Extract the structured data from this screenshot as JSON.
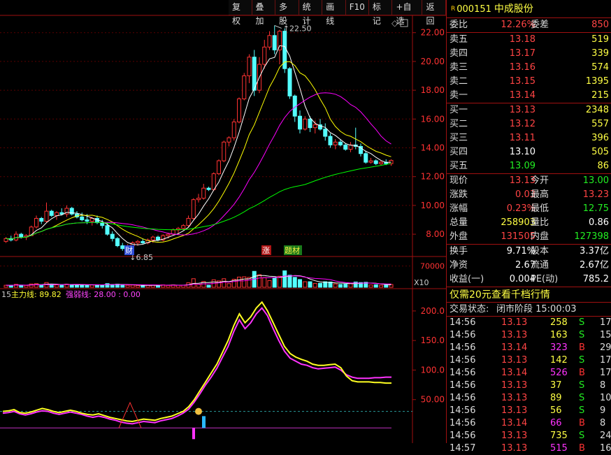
{
  "toolbar": [
    "复权",
    "叠加",
    "多股",
    "统计",
    "画线",
    "F10",
    "标记",
    "+自选",
    "返回"
  ],
  "stock": {
    "marker": "R",
    "code": "000151",
    "name": "中成股份"
  },
  "weibi": {
    "label": "委比",
    "value": "12.26%",
    "label2": "委差",
    "value2": "850"
  },
  "asks": [
    {
      "label": "卖五",
      "price": "13.18",
      "vol": "519"
    },
    {
      "label": "卖四",
      "price": "13.17",
      "vol": "339"
    },
    {
      "label": "卖三",
      "price": "13.16",
      "vol": "574"
    },
    {
      "label": "卖二",
      "price": "13.15",
      "vol": "1395"
    },
    {
      "label": "卖一",
      "price": "13.14",
      "vol": "215"
    }
  ],
  "bids": [
    {
      "label": "买一",
      "price": "13.13",
      "vol": "2348"
    },
    {
      "label": "买二",
      "price": "13.12",
      "vol": "557"
    },
    {
      "label": "买三",
      "price": "13.11",
      "vol": "396"
    },
    {
      "label": "买四",
      "price": "13.10",
      "vol": "505"
    },
    {
      "label": "买五",
      "price": "13.09",
      "vol": "86"
    }
  ],
  "quote": [
    {
      "l1": "现价",
      "v1": "13.13",
      "l2": "今开",
      "v2": "13.00"
    },
    {
      "l1": "涨跌",
      "v1": "0.03",
      "l2": "最高",
      "v2": "13.23"
    },
    {
      "l1": "涨幅",
      "v1": "0.23%",
      "l2": "最低",
      "v2": "12.75"
    },
    {
      "l1": "总量",
      "v1": "258903",
      "l2": "量比",
      "v2": "0.86"
    },
    {
      "l1": "外盘",
      "v1": "131505",
      "l2": "内盘",
      "v2": "127398"
    }
  ],
  "fundamentals": [
    {
      "l1": "换手",
      "v1": "9.71%",
      "l2": "股本",
      "v2": "3.37亿"
    },
    {
      "l1": "净资",
      "v1": "2.67",
      "l2": "流通",
      "v2": "2.67亿"
    },
    {
      "l1": "收益(一)",
      "v1": "0.004",
      "l2": "PE(动)",
      "v2": "785.2"
    }
  ],
  "promo": "仅需20元查看千档行情",
  "status": {
    "label": "交易状态:",
    "value": "闭市阶段 15:00:03"
  },
  "ticks": [
    {
      "time": "14:56",
      "price": "13.13",
      "vol": "258",
      "side": "S",
      "n": "17"
    },
    {
      "time": "14:56",
      "price": "13.13",
      "vol": "163",
      "side": "S",
      "n": "15"
    },
    {
      "time": "14:56",
      "price": "13.14",
      "vol": "323",
      "side": "B",
      "n": "29"
    },
    {
      "time": "14:56",
      "price": "13.13",
      "vol": "142",
      "side": "S",
      "n": "17"
    },
    {
      "time": "14:56",
      "price": "13.14",
      "vol": "526",
      "side": "B",
      "n": "17"
    },
    {
      "time": "14:56",
      "price": "13.13",
      "vol": "37",
      "side": "S",
      "n": "8"
    },
    {
      "time": "14:56",
      "price": "13.13",
      "vol": "89",
      "side": "S",
      "n": "10"
    },
    {
      "time": "14:56",
      "price": "13.13",
      "vol": "56",
      "side": "S",
      "n": "9"
    },
    {
      "time": "14:56",
      "price": "13.14",
      "vol": "66",
      "side": "B",
      "n": "8"
    },
    {
      "time": "14:56",
      "price": "13.13",
      "vol": "735",
      "side": "S",
      "n": "24"
    },
    {
      "time": "14:57",
      "price": "13.13",
      "vol": "515",
      "side": "B",
      "n": "16"
    }
  ],
  "price_axis": [
    "22.00",
    "20.00",
    "18.00",
    "16.00",
    "14.00",
    "12.00",
    "10.00",
    "8.00"
  ],
  "high_label": "22.50",
  "low_label": "6.85",
  "event_labels": [
    "财",
    "涨",
    "题材"
  ],
  "vol_axis": {
    "value": "70000",
    "unit": "X10"
  },
  "indicator": {
    "prefix": "15",
    "main": "主力线: 89.82",
    "strong": "强弱线: 28.00 : 0.00"
  },
  "ind_axis": [
    "200.0",
    "150.0",
    "100.0",
    "50.00"
  ],
  "colors": {
    "up": "#ff3232",
    "down": "#54ffff",
    "ma5": "#ffffff",
    "ma10": "#ffff00",
    "ma20": "#ff00ff",
    "ma60": "#00ff00",
    "border": "#a01010"
  },
  "chart_data": {
    "type": "candlestick",
    "note_series": [
      "MA5",
      "MA10",
      "MA20",
      "MA60"
    ],
    "candles": [
      [
        7.5,
        7.8,
        7.4,
        7.7
      ],
      [
        7.7,
        7.9,
        7.5,
        7.6
      ],
      [
        7.6,
        8.2,
        7.5,
        8.0
      ],
      [
        8.0,
        8.1,
        7.7,
        7.8
      ],
      [
        7.8,
        8.0,
        7.6,
        7.9
      ],
      [
        7.9,
        8.6,
        7.9,
        8.5
      ],
      [
        8.5,
        9.3,
        8.4,
        9.1
      ],
      [
        9.1,
        9.2,
        8.7,
        8.9
      ],
      [
        8.9,
        10.2,
        8.8,
        9.6
      ],
      [
        9.6,
        9.7,
        9.2,
        9.3
      ],
      [
        9.3,
        9.6,
        9.0,
        9.5
      ],
      [
        9.5,
        9.8,
        9.3,
        9.4
      ],
      [
        9.4,
        10.0,
        9.2,
        9.8
      ],
      [
        9.8,
        9.9,
        9.3,
        9.4
      ],
      [
        9.4,
        9.6,
        9.1,
        9.2
      ],
      [
        9.2,
        9.5,
        8.9,
        9.0
      ],
      [
        9.0,
        9.4,
        8.7,
        8.9
      ],
      [
        8.9,
        9.2,
        8.6,
        9.1
      ],
      [
        9.1,
        9.3,
        8.7,
        8.8
      ],
      [
        8.8,
        9.0,
        8.4,
        8.6
      ],
      [
        8.6,
        8.8,
        7.9,
        8.0
      ],
      [
        8.0,
        8.2,
        7.5,
        7.7
      ],
      [
        7.7,
        7.8,
        7.1,
        7.2
      ],
      [
        7.2,
        7.4,
        6.85,
        7.0
      ],
      [
        7.0,
        7.3,
        6.9,
        7.2
      ],
      [
        7.2,
        7.5,
        7.0,
        7.4
      ],
      [
        7.4,
        7.6,
        7.2,
        7.5
      ],
      [
        7.5,
        7.7,
        7.3,
        7.4
      ],
      [
        7.4,
        7.7,
        7.3,
        7.6
      ],
      [
        7.6,
        7.9,
        7.4,
        7.8
      ],
      [
        7.8,
        7.9,
        7.5,
        7.6
      ],
      [
        7.6,
        8.0,
        7.5,
        7.9
      ],
      [
        7.9,
        8.1,
        7.7,
        8.0
      ],
      [
        8.0,
        8.4,
        7.9,
        8.3
      ],
      [
        8.3,
        8.5,
        8.0,
        8.4
      ],
      [
        8.4,
        8.7,
        8.3,
        8.6
      ],
      [
        8.6,
        9.3,
        8.5,
        9.1
      ],
      [
        9.1,
        10.5,
        9.0,
        10.4
      ],
      [
        10.4,
        10.8,
        10.2,
        10.5
      ],
      [
        10.5,
        11.5,
        10.4,
        11.2
      ],
      [
        11.2,
        11.3,
        11.0,
        11.1
      ],
      [
        11.1,
        12.3,
        11.0,
        12.2
      ],
      [
        12.2,
        13.2,
        12.1,
        13.1
      ],
      [
        13.1,
        14.5,
        13.0,
        14.4
      ],
      [
        14.4,
        14.8,
        14.1,
        14.7
      ],
      [
        14.7,
        16.0,
        14.5,
        15.8
      ],
      [
        15.8,
        17.5,
        15.7,
        17.4
      ],
      [
        17.4,
        19.2,
        17.3,
        19.0
      ],
      [
        19.0,
        20.5,
        18.5,
        20.3
      ],
      [
        20.3,
        20.8,
        17.6,
        18.0
      ],
      [
        18.0,
        20.3,
        17.8,
        19.8
      ],
      [
        19.8,
        21.5,
        19.5,
        21.0
      ],
      [
        21.0,
        22.1,
        20.8,
        21.8
      ],
      [
        21.8,
        22.5,
        20.5,
        20.8
      ],
      [
        20.8,
        22.2,
        19.8,
        22.1
      ],
      [
        22.1,
        22.3,
        19.2,
        19.5
      ],
      [
        19.5,
        19.6,
        17.4,
        17.6
      ],
      [
        17.6,
        17.7,
        15.8,
        16.2
      ],
      [
        16.2,
        16.6,
        15.0,
        15.3
      ],
      [
        15.3,
        16.2,
        15.2,
        16.0
      ],
      [
        16.0,
        16.2,
        15.1,
        15.4
      ],
      [
        15.4,
        15.9,
        15.0,
        15.6
      ],
      [
        15.6,
        16.0,
        15.2,
        15.3
      ],
      [
        15.3,
        15.7,
        14.5,
        14.8
      ],
      [
        14.8,
        15.0,
        14.0,
        14.2
      ],
      [
        14.2,
        14.6,
        13.9,
        14.4
      ],
      [
        14.4,
        14.6,
        14.1,
        14.2
      ],
      [
        14.2,
        14.3,
        13.8,
        13.9
      ],
      [
        13.9,
        14.4,
        13.7,
        14.2
      ],
      [
        14.2,
        15.4,
        13.9,
        14.1
      ],
      [
        14.1,
        14.3,
        13.4,
        13.6
      ],
      [
        13.6,
        13.8,
        12.9,
        13.0
      ],
      [
        13.0,
        13.3,
        12.9,
        13.1
      ],
      [
        13.1,
        13.2,
        12.8,
        12.9
      ],
      [
        12.9,
        13.1,
        12.8,
        13.0
      ],
      [
        13.0,
        13.2,
        12.8,
        12.9
      ],
      [
        12.9,
        13.2,
        12.75,
        13.13
      ]
    ],
    "indicator": {
      "main_line": [
        30,
        31,
        33,
        28,
        27,
        29,
        32,
        35,
        33,
        30,
        28,
        30,
        32,
        30,
        27,
        25,
        24,
        26,
        23,
        20,
        18,
        16,
        14,
        13,
        15,
        17,
        16,
        15,
        18,
        20,
        22,
        26,
        30,
        38,
        50,
        65,
        80,
        95,
        110,
        130,
        150,
        175,
        195,
        180,
        190,
        205,
        215,
        200,
        180,
        160,
        140,
        128,
        122,
        118,
        115,
        110,
        108,
        108,
        109,
        110,
        104,
        90,
        82,
        80,
        80,
        80,
        79,
        79,
        78,
        78
      ],
      "strong_line": [
        27,
        28,
        30,
        26,
        24,
        26,
        29,
        31,
        30,
        27,
        25,
        27,
        29,
        27,
        25,
        22,
        20,
        22,
        20,
        17,
        15,
        12,
        10,
        9,
        11,
        13,
        12,
        11,
        14,
        16,
        18,
        22,
        27,
        34,
        46,
        60,
        75,
        88,
        103,
        122,
        140,
        165,
        185,
        170,
        180,
        195,
        205,
        192,
        170,
        150,
        132,
        120,
        115,
        110,
        108,
        104,
        102,
        103,
        104,
        105,
        100,
        92,
        88,
        86,
        86,
        86,
        87,
        87,
        88,
        88
      ],
      "ylim": [
        0,
        220
      ]
    }
  }
}
